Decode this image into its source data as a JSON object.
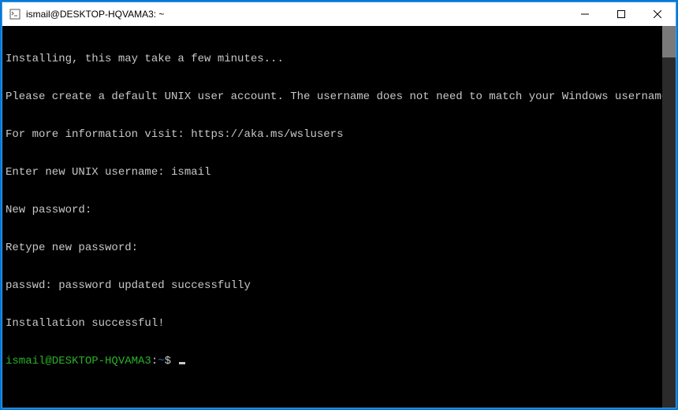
{
  "window": {
    "title": "ismail@DESKTOP-HQVAMA3: ~"
  },
  "terminal": {
    "lines": [
      "Installing, this may take a few minutes...",
      "Please create a default UNIX user account. The username does not need to match your Windows username.",
      "For more information visit: https://aka.ms/wslusers",
      "Enter new UNIX username: ismail",
      "New password:",
      "Retype new password:",
      "passwd: password updated successfully",
      "Installation successful!"
    ],
    "prompt": {
      "userhost": "ismail@DESKTOP-HQVAMA3",
      "colon": ":",
      "path": "~",
      "symbol": "$"
    }
  }
}
